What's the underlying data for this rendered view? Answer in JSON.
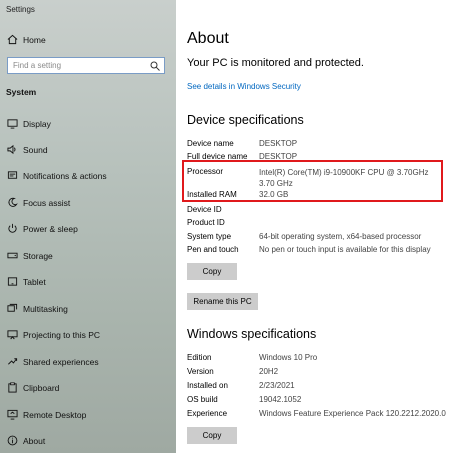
{
  "window": {
    "title": "Settings"
  },
  "sidebar": {
    "home_label": "Home",
    "search_placeholder": "Find a setting",
    "section": "System",
    "items": [
      {
        "label": "Display",
        "icon": "display-icon"
      },
      {
        "label": "Sound",
        "icon": "sound-icon"
      },
      {
        "label": "Notifications & actions",
        "icon": "notifications-icon"
      },
      {
        "label": "Focus assist",
        "icon": "focus-assist-icon"
      },
      {
        "label": "Power & sleep",
        "icon": "power-icon"
      },
      {
        "label": "Storage",
        "icon": "storage-icon"
      },
      {
        "label": "Tablet",
        "icon": "tablet-icon"
      },
      {
        "label": "Multitasking",
        "icon": "multitasking-icon"
      },
      {
        "label": "Projecting to this PC",
        "icon": "projecting-icon"
      },
      {
        "label": "Shared experiences",
        "icon": "shared-experiences-icon"
      },
      {
        "label": "Clipboard",
        "icon": "clipboard-icon"
      },
      {
        "label": "Remote Desktop",
        "icon": "remote-desktop-icon"
      },
      {
        "label": "About",
        "icon": "info-icon"
      }
    ]
  },
  "main": {
    "title": "About",
    "protection_text": "Your PC is monitored and protected.",
    "security_link": "See details in Windows Security",
    "device_spec_title": "Device specifications",
    "device_specs": [
      {
        "key": "Device name",
        "value": "DESKTOP"
      },
      {
        "key": "Full device name",
        "value": "DESKTOP"
      },
      {
        "key": "Processor",
        "value": "Intel(R) Core(TM) i9-10900KF CPU @ 3.70GHz   3.70 GHz"
      },
      {
        "key": "Installed RAM",
        "value": "32.0 GB"
      },
      {
        "key": "Device ID",
        "value": ""
      },
      {
        "key": "Product ID",
        "value": ""
      },
      {
        "key": "System type",
        "value": "64-bit operating system, x64-based processor"
      },
      {
        "key": "Pen and touch",
        "value": "No pen or touch input is available for this display"
      }
    ],
    "copy_label_1": "Copy",
    "rename_label": "Rename this PC",
    "windows_spec_title": "Windows specifications",
    "windows_specs": [
      {
        "key": "Edition",
        "value": "Windows 10 Pro"
      },
      {
        "key": "Version",
        "value": "20H2"
      },
      {
        "key": "Installed on",
        "value": "2/23/2021"
      },
      {
        "key": "OS build",
        "value": "19042.1052"
      },
      {
        "key": "Experience",
        "value": "Windows Feature Experience Pack 120.2212.2020.0"
      }
    ],
    "copy_label_2": "Copy"
  },
  "colors": {
    "link": "#0067c0",
    "highlight": "#e0191c",
    "button": "#cccccc"
  }
}
